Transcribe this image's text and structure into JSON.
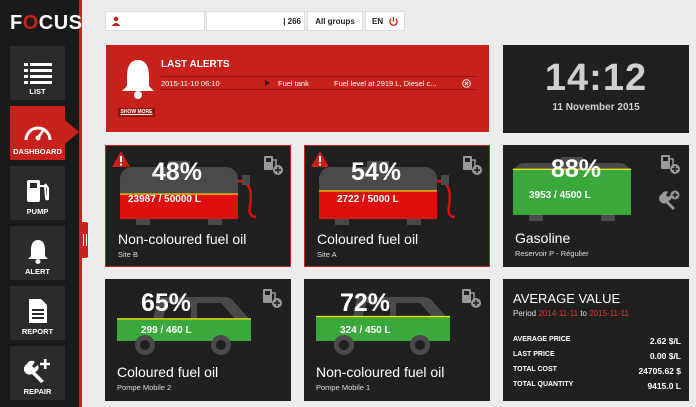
{
  "brand": {
    "logo_text_pre": "F",
    "logo_ring": "O",
    "logo_text_post": "CUS",
    "accent": "#c8201a"
  },
  "sidebar": {
    "items": [
      {
        "label": "LIST",
        "icon": "list-icon"
      },
      {
        "label": "DASHBOARD",
        "icon": "gauge-icon",
        "active": true
      },
      {
        "label": "PUMP",
        "icon": "pump-icon"
      },
      {
        "label": "ALERT",
        "icon": "bell-icon"
      },
      {
        "label": "REPORT",
        "icon": "document-icon"
      },
      {
        "label": "REPAIR",
        "icon": "wrench-icon"
      }
    ]
  },
  "topbar": {
    "count": "| 266",
    "groups": "All groups",
    "lang": "EN"
  },
  "alerts": {
    "title": "LAST ALERTS",
    "show_more": "SHOW MORE",
    "rows": [
      {
        "timestamp": "2015-11-10 06:10",
        "source": "Fuel tank",
        "message": "Fuel level at 2919 L, Diesel c..."
      }
    ]
  },
  "clock": {
    "time": "14:12",
    "date": "11 November 2015"
  },
  "cards": [
    {
      "pct": "48%",
      "fill": 0.48,
      "qty": "23987 / 50000 L",
      "name": "Non-coloured fuel oil",
      "site": "Site B",
      "kind": "tank",
      "color": "#e00f0f",
      "warning": true
    },
    {
      "pct": "54%",
      "fill": 0.54,
      "qty": "2722 / 5000 L",
      "name": "Coloured fuel oil",
      "site": "Site A",
      "kind": "tank",
      "color": "#e00f0f",
      "warning": true
    },
    {
      "pct": "88%",
      "fill": 0.88,
      "qty": "3953 / 4500 L",
      "name": "Gasoline",
      "site": "Reservoir P - Régulier",
      "kind": "tank",
      "color": "#3aa83a",
      "warning": false
    },
    {
      "pct": "65%",
      "fill": 0.65,
      "qty": "299 / 460 L",
      "name": "Coloured fuel oil",
      "site": "Pompe Mobile 2",
      "kind": "truck",
      "color": "#3aa83a",
      "warning": false
    },
    {
      "pct": "72%",
      "fill": 0.72,
      "qty": "324 / 450 L",
      "name": "Non-coloured fuel oil",
      "site": "Pompe Mobile 1",
      "kind": "truck",
      "color": "#3aa83a",
      "warning": false
    }
  ],
  "average": {
    "title": "AVERAGE VALUE",
    "period_label": "Period",
    "period_from": "2014-11-11",
    "period_to_word": "to",
    "period_to": "2015-11-11",
    "stats": [
      {
        "label": "AVERAGE PRICE",
        "value": "2.62 $/L"
      },
      {
        "label": "LAST PRICE",
        "value": "0.00 $/L"
      },
      {
        "label": "TOTAL COST",
        "value": "24705.62 $"
      },
      {
        "label": "TOTAL QUANTITY",
        "value": "9415.0 L"
      }
    ]
  }
}
